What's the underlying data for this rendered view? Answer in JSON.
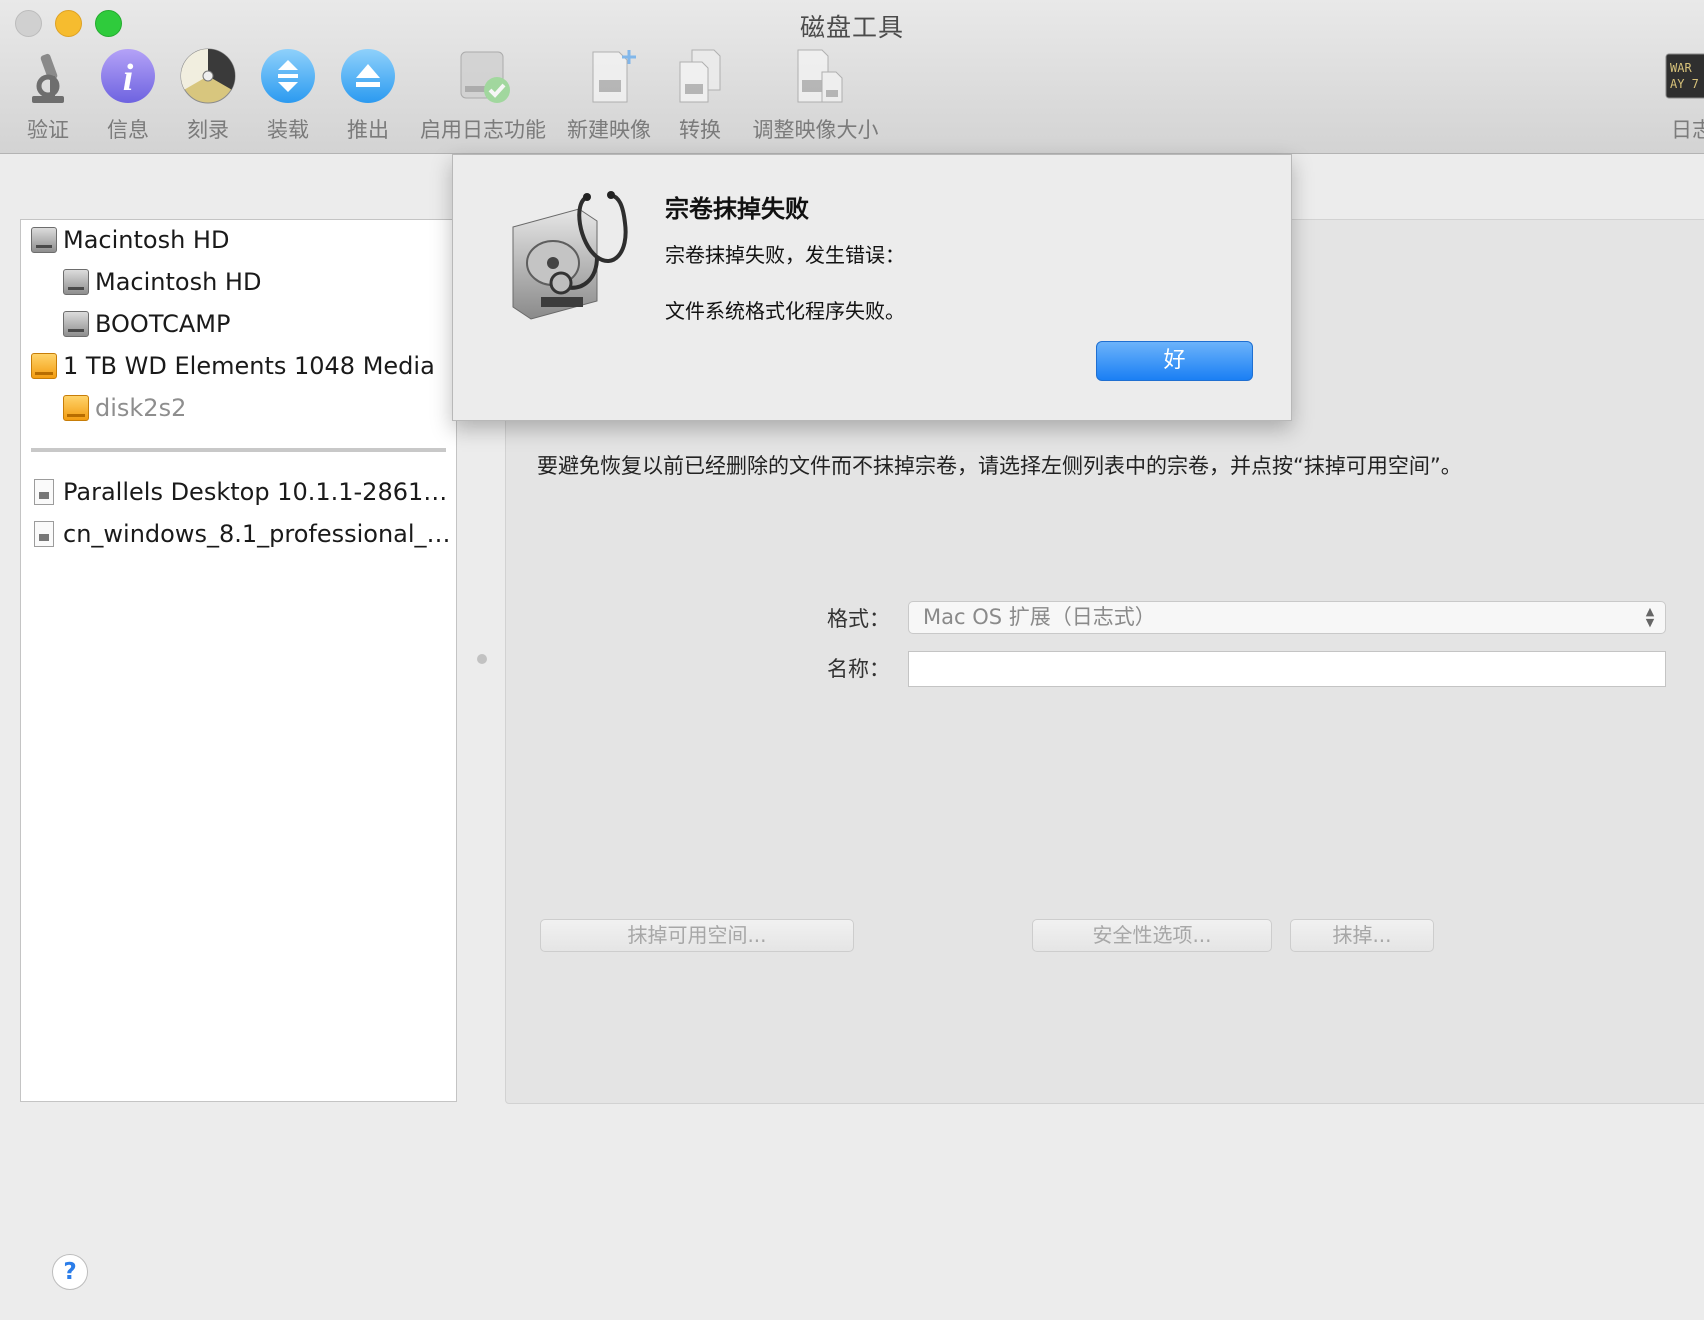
{
  "window": {
    "title": "磁盘工具"
  },
  "toolbar": {
    "items": [
      {
        "label": "验证",
        "icon": "microscope-icon"
      },
      {
        "label": "信息",
        "icon": "info-icon"
      },
      {
        "label": "刻录",
        "icon": "burn-icon"
      },
      {
        "label": "装载",
        "icon": "mount-icon"
      },
      {
        "label": "推出",
        "icon": "eject-icon"
      },
      {
        "label": "启用日志功能",
        "icon": "enable-journaling-icon"
      },
      {
        "label": "新建映像",
        "icon": "new-image-icon"
      },
      {
        "label": "转换",
        "icon": "convert-icon"
      },
      {
        "label": "调整映像大小",
        "icon": "resize-image-icon"
      },
      {
        "label": "日志",
        "icon": "log-icon"
      }
    ]
  },
  "sidebar": {
    "items": [
      {
        "label": "Macintosh HD",
        "icon": "internal-disk-icon"
      },
      {
        "label": "Macintosh HD",
        "icon": "volume-icon"
      },
      {
        "label": "BOOTCAMP",
        "icon": "volume-icon"
      },
      {
        "label": "1 TB WD Elements 1048 Media",
        "icon": "external-disk-icon"
      },
      {
        "label": "disk2s2",
        "icon": "external-volume-icon"
      }
    ],
    "images": [
      {
        "label": "Parallels Desktop 10.1.1-2861…",
        "icon": "disk-image-icon"
      },
      {
        "label": "cn_windows_8.1_professional_…",
        "icon": "disk-image-icon"
      }
    ]
  },
  "main": {
    "description": "要避免恢复以前已经删除的文件而不抹掉宗卷，请选择左侧列表中的宗卷，并点按“抹掉可用空间”。",
    "format_label": "格式：",
    "format_value": "Mac OS 扩展（日志式）",
    "name_label": "名称：",
    "name_value": "",
    "erase_free_space_button": "抹掉可用空间...",
    "security_options_button": "安全性选项...",
    "erase_button": "抹掉..."
  },
  "alert": {
    "title": "宗卷抹掉失败",
    "message1": "宗卷抹掉失败，发生错误：",
    "message2": "文件系统格式化程序失败。",
    "ok_button": "好",
    "icon": "disk-utility-stethoscope-icon"
  },
  "help": {
    "label": "?"
  },
  "colors": {
    "accent": "#1a7ff4",
    "external_disk": "#f39d12"
  }
}
